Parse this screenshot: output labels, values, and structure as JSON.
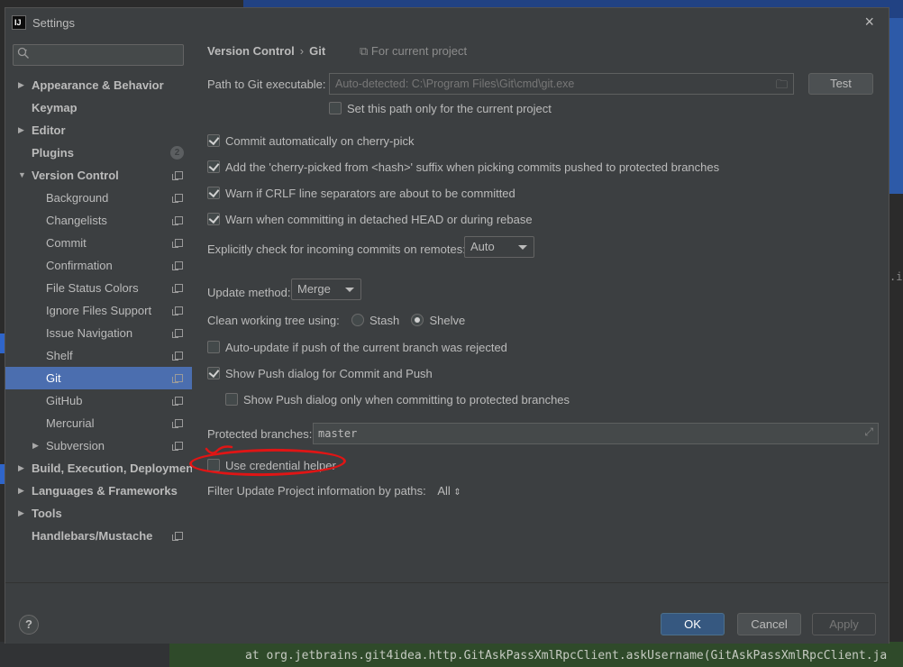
{
  "ide": {
    "console_line": "at org.jetbrains.git4idea.http.GitAskPassXmlRpcClient.askUsername(GitAskPassXmlRpcClient.ja",
    "right_fragment": ".ie"
  },
  "dialog": {
    "app_icon": "IJ",
    "title": "Settings",
    "close_label": "×"
  },
  "sidebar": {
    "search_placeholder": "",
    "items": [
      {
        "label": "Appearance & Behavior"
      },
      {
        "label": "Keymap"
      },
      {
        "label": "Editor"
      },
      {
        "label": "Plugins",
        "badge": "2"
      },
      {
        "label": "Version Control"
      },
      {
        "label": "Background"
      },
      {
        "label": "Changelists"
      },
      {
        "label": "Commit"
      },
      {
        "label": "Confirmation"
      },
      {
        "label": "File Status Colors"
      },
      {
        "label": "Ignore Files Support"
      },
      {
        "label": "Issue Navigation"
      },
      {
        "label": "Shelf"
      },
      {
        "label": "Git"
      },
      {
        "label": "GitHub"
      },
      {
        "label": "Mercurial"
      },
      {
        "label": "Subversion"
      },
      {
        "label": "Build, Execution, Deployment"
      },
      {
        "label": "Languages & Frameworks"
      },
      {
        "label": "Tools"
      },
      {
        "label": "Handlebars/Mustache"
      }
    ]
  },
  "content": {
    "breadcrumb": [
      "Version Control",
      "Git"
    ],
    "breadcrumb_sep": "›",
    "for_project": "For current project",
    "path_label": "Path to Git executable:",
    "path_value": "Auto-detected: C:\\Program Files\\Git\\cmd\\git.exe",
    "test_button": "Test",
    "set_path_only": "Set this path only for the current project",
    "commit_cherry_pick": "Commit automatically on cherry-pick",
    "cherry_picked_suffix": "Add the 'cherry-picked from <hash>' suffix when picking commits pushed to protected branches",
    "warn_crlf": "Warn if CRLF line separators are about to be committed",
    "warn_detached": "Warn when committing in detached HEAD or during rebase",
    "incoming_label": "Explicitly check for incoming commits on remotes:",
    "incoming_value": "Auto",
    "update_method_label": "Update method:",
    "update_method_value": "Merge",
    "clean_tree_label": "Clean working tree using:",
    "stash_label": "Stash",
    "shelve_label": "Shelve",
    "auto_update": "Auto-update if push of the current branch was rejected",
    "show_push_dialog": "Show Push dialog for Commit and Push",
    "show_push_protected": "Show Push dialog only when committing to protected branches",
    "protected_label": "Protected branches:",
    "protected_value": "master",
    "use_credential_helper": "Use credential helper",
    "filter_label": "Filter Update Project information by paths:",
    "filter_value": "All",
    "filter_caret": "⇕"
  },
  "footer": {
    "help": "?",
    "ok": "OK",
    "cancel": "Cancel",
    "apply": "Apply"
  },
  "colors": {
    "dialog_bg": "#3c3f41",
    "selection": "#4b6eaf",
    "ok_button": "#365880",
    "annotation": "#e01515"
  }
}
